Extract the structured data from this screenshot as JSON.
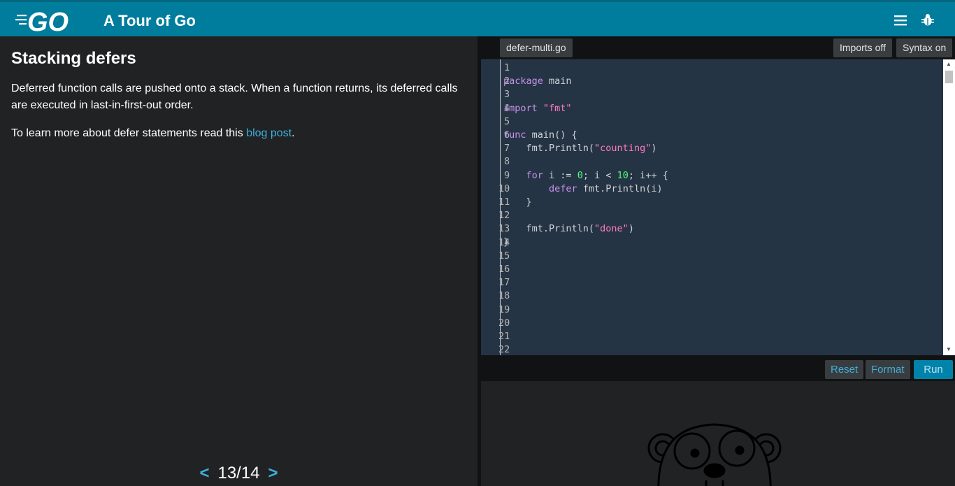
{
  "header": {
    "logo_text": "GO",
    "title": "A Tour of Go",
    "icons": [
      "theme-toggle-icon",
      "menu-icon",
      "debug-icon"
    ]
  },
  "lesson": {
    "title": "Stacking defers",
    "p1": "Deferred function calls are pushed onto a stack. When a function returns, its deferred calls are executed in last-in-first-out order.",
    "p2_prefix": "To learn more about defer statements read this ",
    "p2_link": "blog post",
    "p2_suffix": ".",
    "page_number": "13/14",
    "prev": "<",
    "next": ">"
  },
  "editor": {
    "filename": "defer-multi.go",
    "imports_label": "Imports off",
    "syntax_label": "Syntax on",
    "line_numbers": [
      "1",
      "2",
      "3",
      "4",
      "5",
      "6",
      "7",
      "8",
      "9",
      "10",
      "11",
      "12",
      "13",
      "14",
      "15",
      "16",
      "17",
      "18",
      "19",
      "20",
      "21",
      "22"
    ]
  },
  "controls": {
    "reset": "Reset",
    "format": "Format",
    "run": "Run"
  },
  "colors": {
    "header": "#007d9c",
    "accent": "#3db0dc",
    "editor_bg": "#253444"
  }
}
